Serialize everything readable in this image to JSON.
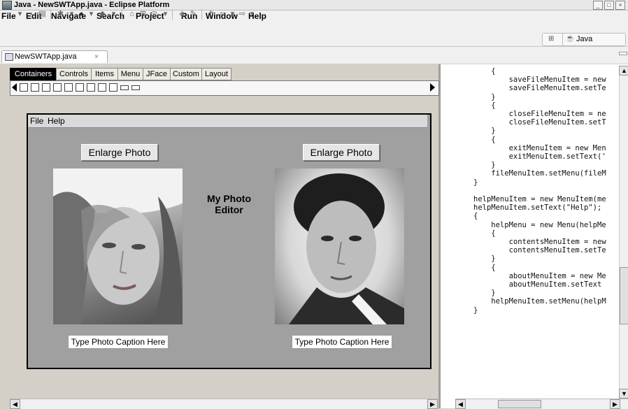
{
  "window": {
    "title": "Java - NewSWTApp.java - Eclipse Platform",
    "buttons": [
      "minimize-button",
      "maximize-button",
      "close-button"
    ]
  },
  "menubar": {
    "items": [
      "File",
      "Edit",
      "Navigate",
      "Search",
      "Project",
      "Run",
      "Window",
      "Help"
    ]
  },
  "perspective": {
    "label": "Java"
  },
  "editor_tab": {
    "label": "NewSWTApp.java",
    "close": "×"
  },
  "palette": {
    "tabs": [
      "Containers",
      "Controls",
      "Items",
      "Menu",
      "JFace",
      "Custom",
      "Layout"
    ],
    "active_tab": "Containers"
  },
  "shell": {
    "menu": [
      "File",
      "Help"
    ],
    "left_button": "Enlarge Photo",
    "right_button": "Enlarge Photo",
    "center_label": "My Photo Editor",
    "left_caption": "Type Photo Caption Here",
    "right_caption": "Type Photo Caption Here"
  },
  "code": {
    "lines": [
      "    {",
      "        saveFileMenuItem = new",
      "        saveFileMenuItem.setTe",
      "    }",
      "    {",
      "        closeFileMenuItem = ne",
      "        closeFileMenuItem.setT",
      "    }",
      "    {",
      "        exitMenuItem = new Men",
      "        exitMenuItem.setText('",
      "    }",
      "    fileMenuItem.setMenu(fileM",
      "}",
      "",
      "helpMenuItem = new MenuItem(me",
      "helpMenuItem.setText(\"Help\");",
      "{",
      "    helpMenu = new Menu(helpMe",
      "    {",
      "        contentsMenuItem = new",
      "        contentsMenuItem.setTe",
      "    }",
      "    {",
      "        aboutMenuItem = new Me",
      "        aboutMenuItem.setText",
      "    }",
      "    helpMenuItem.setMenu(helpM",
      "}"
    ]
  },
  "colors": {
    "background": "#d4d0c8",
    "shell_background": "#a0a0a0",
    "active_tab": "#000000"
  }
}
